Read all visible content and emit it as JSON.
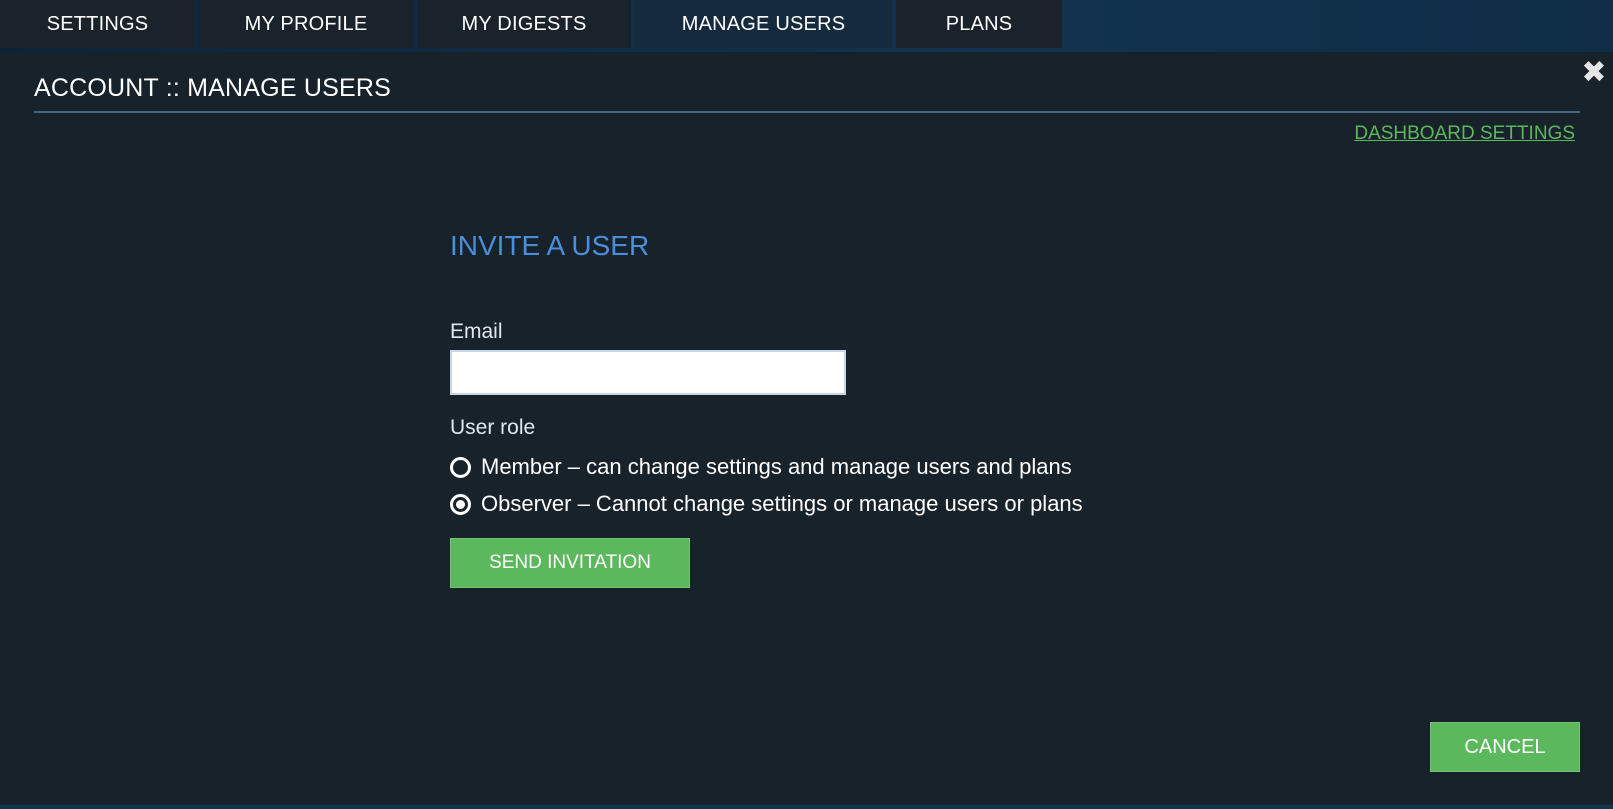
{
  "tabs": [
    {
      "label": "SETTINGS",
      "active": false
    },
    {
      "label": "MY PROFILE",
      "active": false
    },
    {
      "label": "MY DIGESTS",
      "active": false
    },
    {
      "label": "MANAGE USERS",
      "active": true
    },
    {
      "label": "PLANS",
      "active": false
    }
  ],
  "panel": {
    "title": "ACCOUNT :: MANAGE USERS",
    "close_icon": "close-icon",
    "dashboard_link": "DASHBOARD SETTINGS"
  },
  "form": {
    "heading": "INVITE A USER",
    "email_label": "Email",
    "email_value": "",
    "email_placeholder": "",
    "role_label": "User role",
    "roles": [
      {
        "label": "Member – can change settings and manage users and plans",
        "checked": false
      },
      {
        "label": "Observer – Cannot change settings or manage users or plans",
        "checked": true
      }
    ],
    "send_label": "SEND INVITATION"
  },
  "footer": {
    "cancel_label": "CANCEL"
  },
  "colors": {
    "accent_green": "#5cb85c",
    "heading_blue": "#4a8fdb",
    "panel_bg": "#18222b"
  }
}
